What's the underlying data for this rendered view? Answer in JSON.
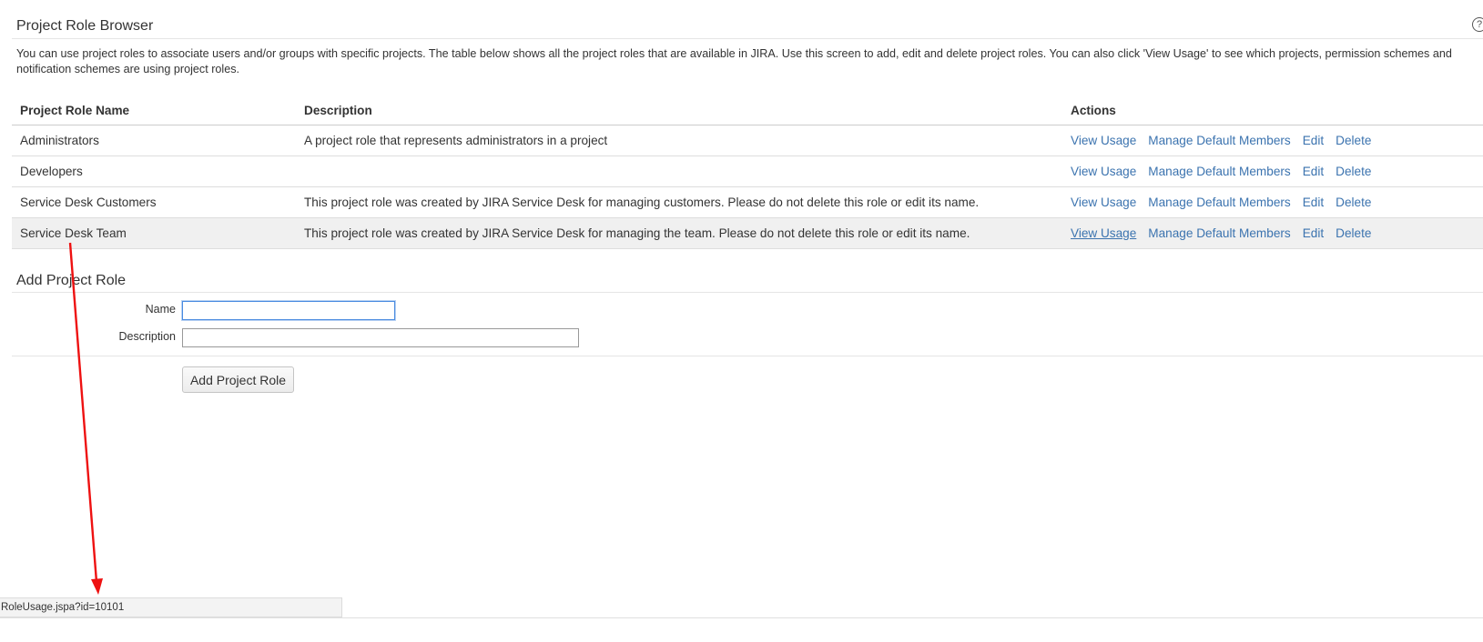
{
  "page": {
    "title": "Project Role Browser",
    "help_icon": "help-icon",
    "intro": "You can use project roles to associate users and/or groups with specific projects. The table below shows all the project roles that are available in JIRA. Use this screen to add, edit and delete project roles. You can also click 'View Usage' to see which projects, permission schemes and notification schemes are using project roles."
  },
  "table": {
    "headers": {
      "name": "Project Role Name",
      "description": "Description",
      "actions": "Actions"
    },
    "rows": [
      {
        "name": "Administrators",
        "description": "A project role that represents administrators in a project",
        "hovered": false
      },
      {
        "name": "Developers",
        "description": "",
        "hovered": false
      },
      {
        "name": "Service Desk Customers",
        "description": "This project role was created by JIRA Service Desk for managing customers. Please do not delete this role or edit its name.",
        "hovered": false
      },
      {
        "name": "Service Desk Team",
        "description": "This project role was created by JIRA Service Desk for managing the team. Please do not delete this role or edit its name.",
        "hovered": true
      }
    ],
    "actions": {
      "view_usage": "View Usage",
      "manage_members": "Manage Default Members",
      "edit": "Edit",
      "delete": "Delete"
    },
    "link_color": "#3b73af",
    "hover_color": "#f0f0f0"
  },
  "add_form": {
    "title": "Add Project Role",
    "name_label": "Name",
    "name_value": "",
    "description_label": "Description",
    "description_value": "",
    "submit_label": "Add Project Role"
  },
  "annotation": {
    "arrow_color": "#ee1111"
  },
  "status_bar": {
    "url": "RoleUsage.jspa?id=10101"
  }
}
